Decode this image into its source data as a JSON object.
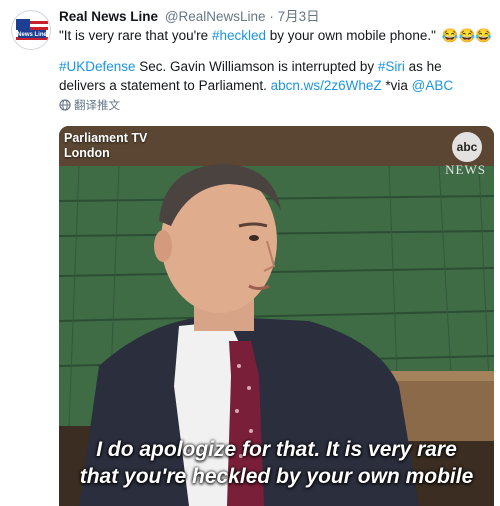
{
  "tweet": {
    "author_name": "Real News Line",
    "author_handle": "@RealNewsLine",
    "separator": "·",
    "date": "7月3日",
    "avatar_text": "News Line",
    "text_line1_before": "\"It is very rare that you're ",
    "hashtag_heckled": "#heckled",
    "text_line1_after": " by your own mobile phone.\"",
    "emoji": "😂😂😂",
    "hashtag_ukdefense": "#UKDefense",
    "text2_part1": " Sec. Gavin Williamson is interrupted by ",
    "hashtag_siri": "#Siri",
    "text2_part2": " as he delivers a statement to Parliament. ",
    "link": "abcn.ws/2z6WheZ",
    "text2_part3": " *via ",
    "mention": "@ABC",
    "translate_label": "翻译推文"
  },
  "media": {
    "overlay_title": "Parliament TV",
    "overlay_location": "London",
    "logo": "abc",
    "logo_subtitle": "NEWS",
    "subtitle_line1": "I do apologize for that. It is very rare",
    "subtitle_line2": "that you're heckled by your own mobile"
  },
  "colors": {
    "link": "#1b95e0",
    "muted": "#657786",
    "text": "#14171a",
    "bench_green": "#3f6b45"
  }
}
